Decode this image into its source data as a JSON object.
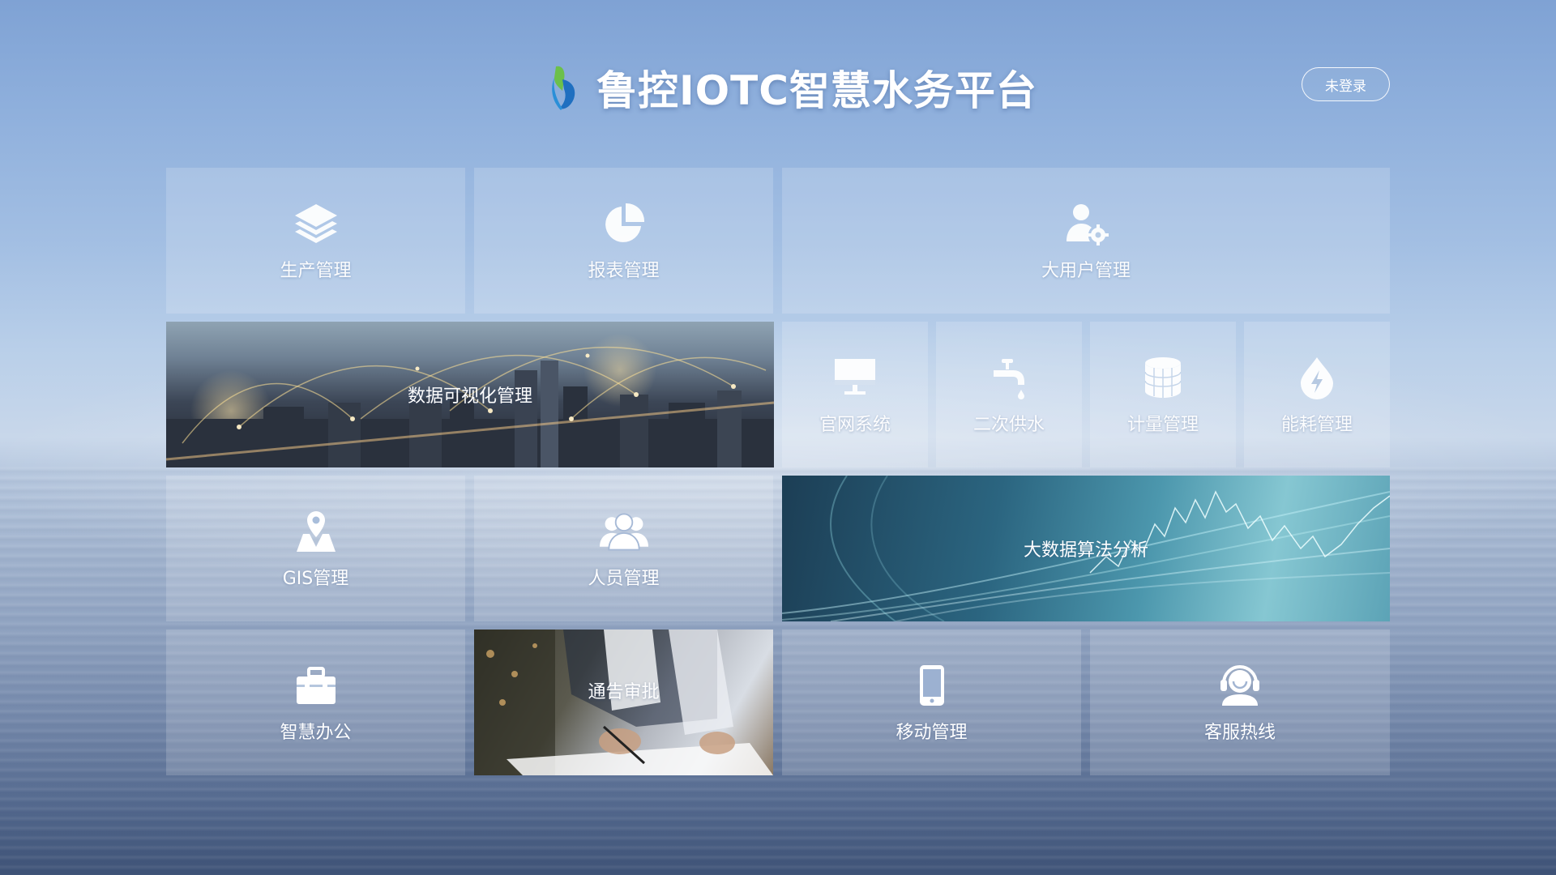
{
  "header": {
    "title": "鲁控IOTC智慧水务平台",
    "login_label": "未登录",
    "logo_icon": "brand-logo-icon"
  },
  "tiles": {
    "production": {
      "label": "生产管理",
      "icon": "layers-icon"
    },
    "reports": {
      "label": "报表管理",
      "icon": "pie-chart-icon"
    },
    "major_users": {
      "label": "大用户管理",
      "icon": "user-settings-icon"
    },
    "data_viz": {
      "label": "数据可视化管理",
      "icon": "city-night-image"
    },
    "website": {
      "label": "官网系统",
      "icon": "monitor-icon"
    },
    "secondary_supply": {
      "label": "二次供水",
      "icon": "faucet-icon"
    },
    "metering": {
      "label": "计量管理",
      "icon": "database-icon"
    },
    "energy": {
      "label": "能耗管理",
      "icon": "energy-drop-icon"
    },
    "gis": {
      "label": "GIS管理",
      "icon": "map-pin-icon"
    },
    "personnel": {
      "label": "人员管理",
      "icon": "users-icon"
    },
    "bigdata": {
      "label": "大数据算法分析",
      "icon": "data-waves-image"
    },
    "office": {
      "label": "智慧办公",
      "icon": "briefcase-icon"
    },
    "notice": {
      "label": "通告审批",
      "icon": "signing-document-image"
    },
    "mobile": {
      "label": "移动管理",
      "icon": "mobile-phone-icon"
    },
    "service": {
      "label": "客服热线",
      "icon": "headset-icon"
    }
  },
  "colors": {
    "sky_top": "#7fa2d4",
    "water_bottom": "#3e5276",
    "logo_green": "#6cc04a",
    "logo_blue": "#1f6fc0"
  }
}
